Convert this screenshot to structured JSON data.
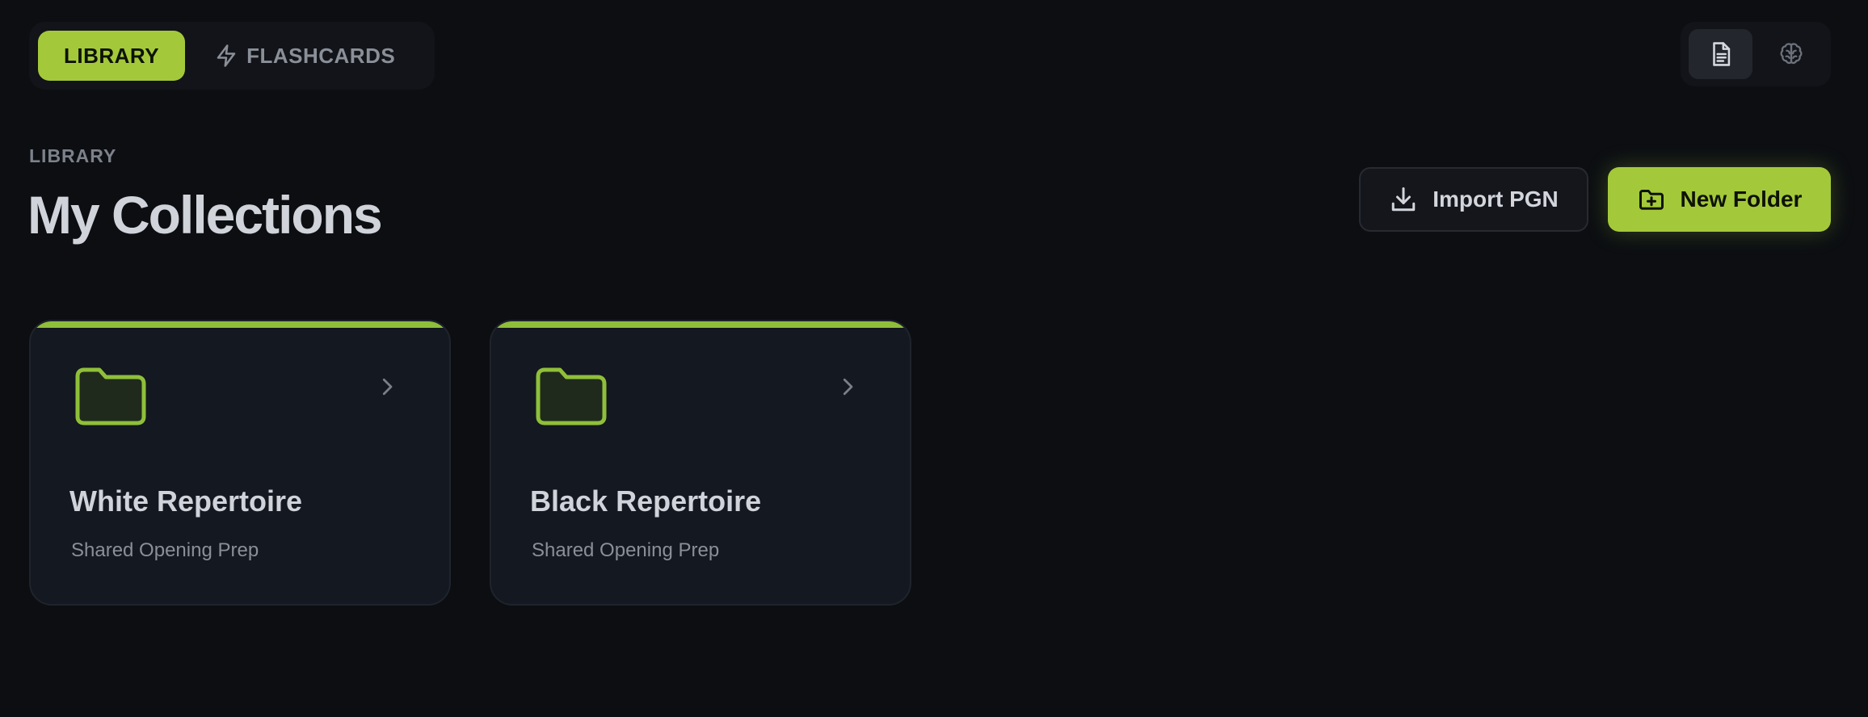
{
  "nav": {
    "tabs": [
      {
        "label": "LIBRARY",
        "active": true
      },
      {
        "label": "FLASHCARDS",
        "icon": "lightning-icon",
        "active": false
      }
    ]
  },
  "view_switch": {
    "buttons": [
      {
        "icon": "document-icon",
        "active": true
      },
      {
        "icon": "brain-icon",
        "active": false
      }
    ]
  },
  "header": {
    "eyebrow": "LIBRARY",
    "title": "My Collections"
  },
  "actions": {
    "import_label": "Import PGN",
    "import_icon": "download-icon",
    "new_folder_label": "New Folder",
    "new_folder_icon": "folder-plus-icon"
  },
  "collections": [
    {
      "title": "White Repertoire",
      "subtitle": "Shared Opening Prep",
      "icon": "folder-icon"
    },
    {
      "title": "Black Repertoire",
      "subtitle": "Shared Opening Prep",
      "icon": "folder-icon"
    }
  ],
  "colors": {
    "accent": "#a3c93a",
    "background": "#0c0e12",
    "card": "#141820"
  }
}
